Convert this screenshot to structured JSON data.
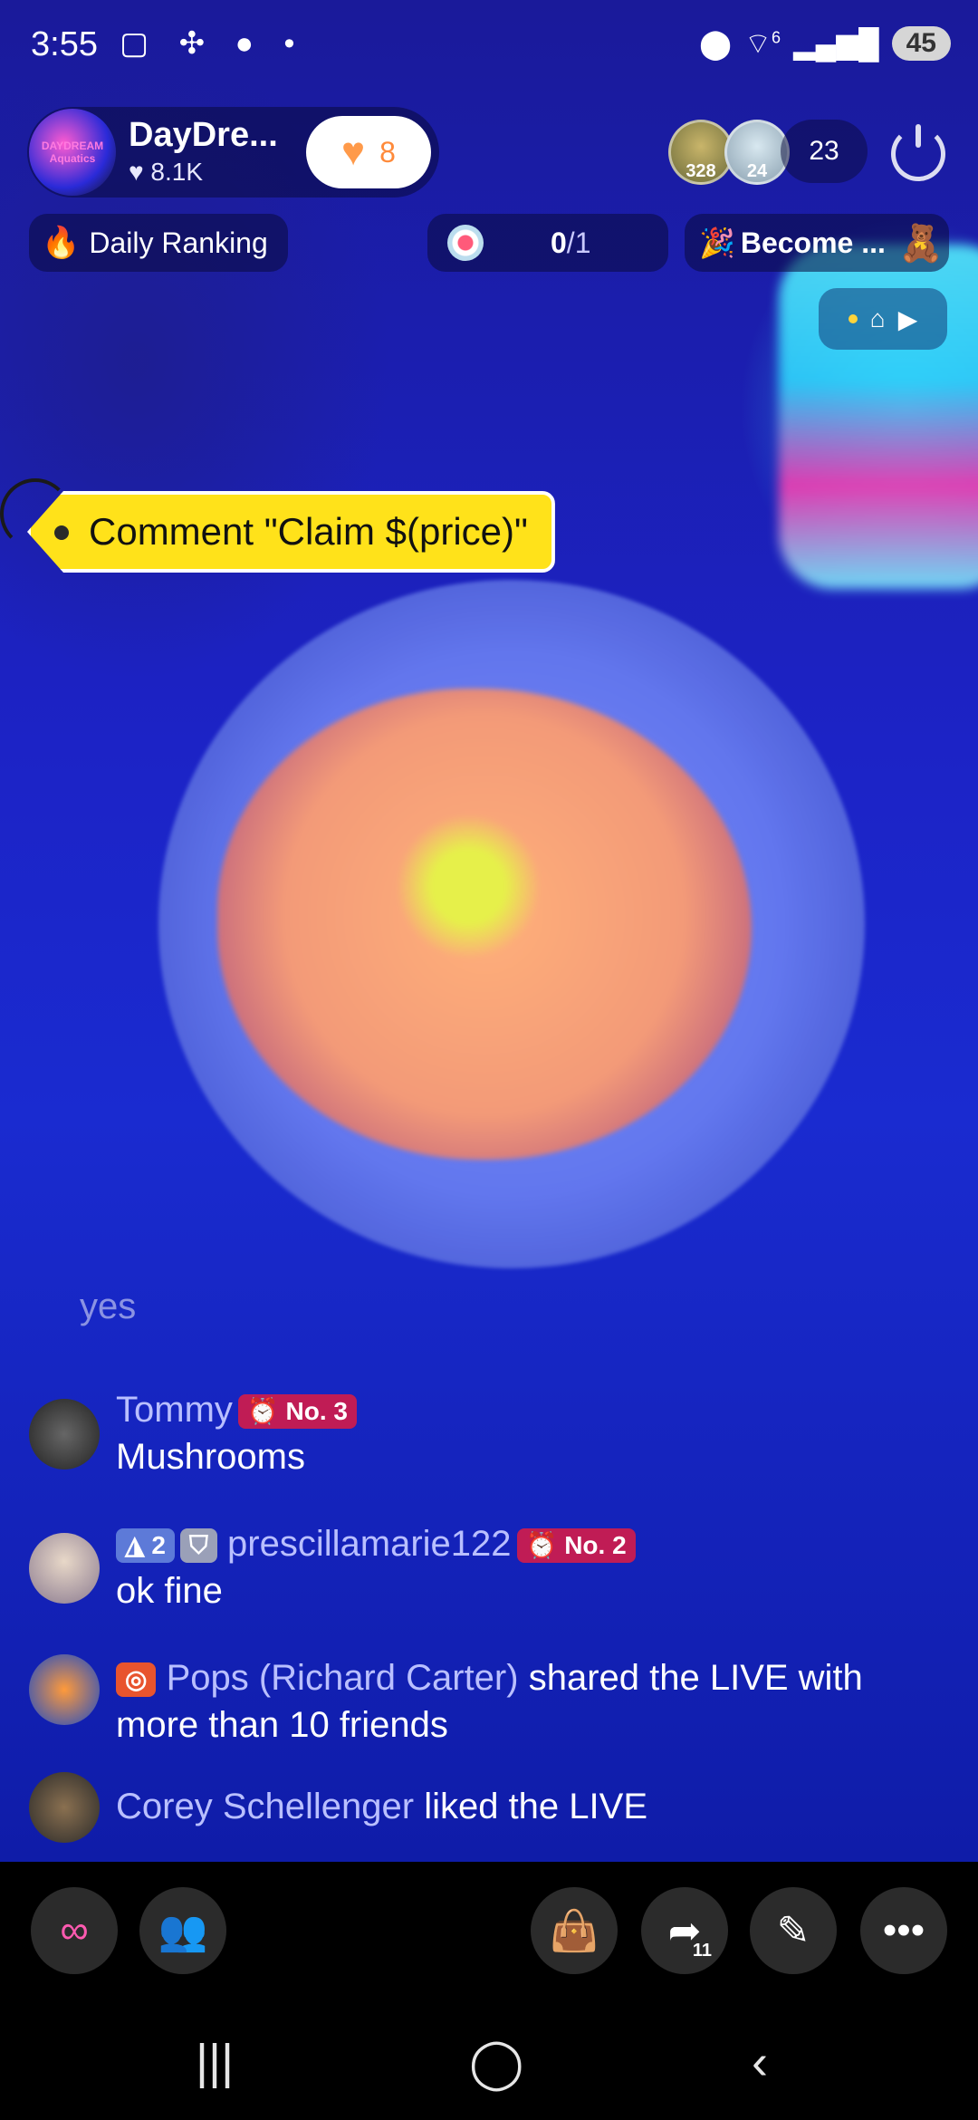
{
  "status_bar": {
    "time": "3:55",
    "left_icons": "▢ ✣ ● •",
    "wifi_label": "6",
    "battery": "45"
  },
  "host": {
    "avatar_label": "DAYDREAM Aquatics",
    "name": "DayDre...",
    "likes": "8.1K",
    "like_count": "8"
  },
  "viewers": {
    "v1_badge": "328",
    "v2_badge": "24",
    "count": "23"
  },
  "row2": {
    "ranking_label": "Daily Ranking",
    "goal_current": "0",
    "goal_total": "/1",
    "become_label": "Become ..."
  },
  "comment_tag": "Comment \"Claim $(price)\"",
  "chat": {
    "previous_fragment": "yes",
    "messages": [
      {
        "user": "Tommy",
        "badge": "No. 3",
        "text": "Mushrooms"
      },
      {
        "level": "2",
        "user": "prescillamarie122",
        "badge": "No. 2",
        "text": "ok fine"
      },
      {
        "user": "Pops (Richard Carter)",
        "text": "shared the LIVE with more than 10 friends"
      },
      {
        "user": "Corey Schellenger",
        "text": "liked the LIVE"
      }
    ]
  },
  "bottom_bar": {
    "share_count": "11"
  },
  "colors": {
    "accent_yellow": "#ffe21a",
    "badge_red": "#c01c55",
    "username_color": "#b9bfff"
  }
}
